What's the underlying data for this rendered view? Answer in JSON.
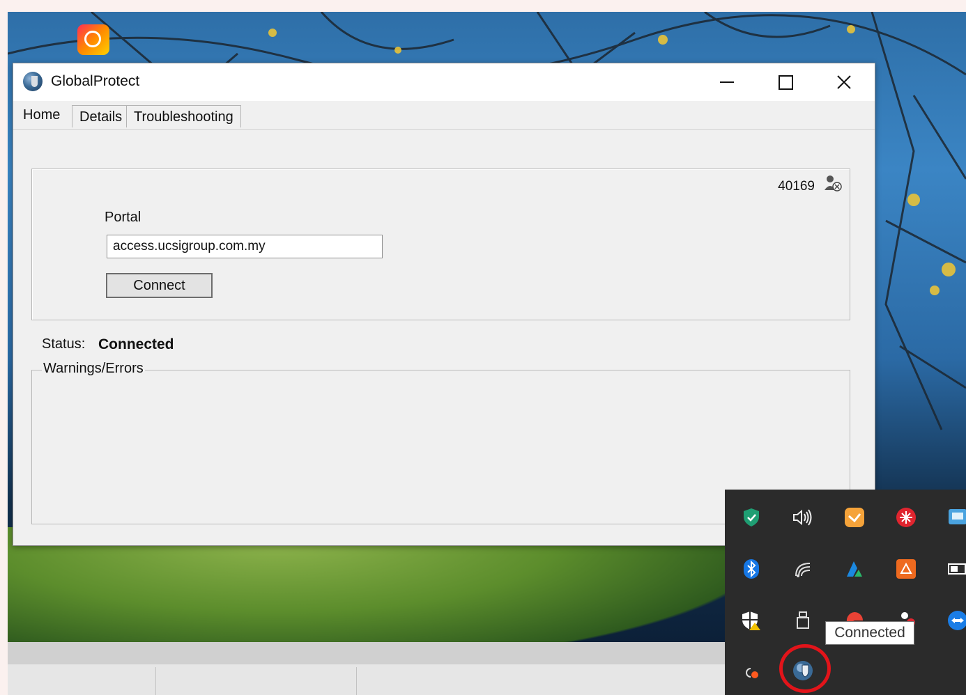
{
  "window": {
    "title": "GlobalProtect",
    "controls": {
      "minimize": "—",
      "maximize": "☐",
      "close": "✕"
    }
  },
  "tabs": [
    {
      "label": "Home",
      "active": true
    },
    {
      "label": "Details",
      "active": false
    },
    {
      "label": "Troubleshooting",
      "active": false
    }
  ],
  "home": {
    "user_id": "40169",
    "portal_label": "Portal",
    "portal_value": "access.ucsigroup.com.my",
    "connect_label": "Connect",
    "status_label": "Status:",
    "status_value": "Connected",
    "warnings_label": "Warnings/Errors"
  },
  "tray": {
    "tooltip": "Connected",
    "icons": [
      "defender-shield-icon",
      "volume-icon",
      "mail-app-icon",
      "red-app-icon",
      "network-app-icon",
      "bluetooth-icon",
      "wifi-icon",
      "azure-icon",
      "orange-app-icon",
      "battery-icon",
      "security-warning-icon",
      "usb-device-icon",
      "chrome-app-icon",
      "red-dot-app-icon",
      "teamviewer-icon",
      "cloud-sync-icon",
      "globalprotect-icon"
    ]
  }
}
